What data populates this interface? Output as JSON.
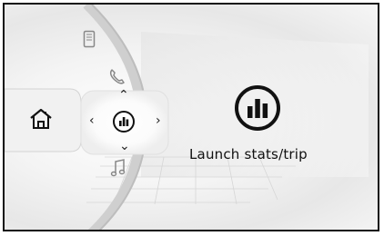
{
  "main": {
    "action_label": "Launch stats/trip"
  },
  "icons": {
    "home": "home-icon",
    "phone_app": "mobile-phone-icon",
    "phone": "phone-handset-icon",
    "stats": "bar-chart-icon",
    "music": "music-note-icon"
  },
  "colors": {
    "frame": "#111111",
    "icon_dark": "#111111",
    "icon_faded": "#888888"
  }
}
